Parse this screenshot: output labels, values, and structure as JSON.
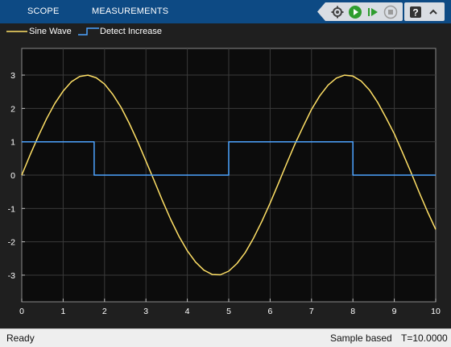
{
  "toolstrip": {
    "tabs": [
      "SCOPE",
      "MEASUREMENTS"
    ],
    "quick_access": [
      "settings-icon",
      "run-icon",
      "step-forward-icon",
      "stop-icon",
      "help-icon",
      "collapse-icon"
    ],
    "colors": {
      "bar": "#0d4a84",
      "run": "#2e9d2e",
      "stop": "#9a9a9a"
    }
  },
  "legend": {
    "items": [
      {
        "label": "Sine Wave",
        "color": "#ffe066"
      },
      {
        "label": "Detect Increase",
        "color": "#4da3ff"
      }
    ]
  },
  "chart_data": {
    "type": "line",
    "xlim": [
      0,
      10
    ],
    "ylim": [
      -3.8,
      3.8
    ],
    "xticks": [
      0,
      1,
      2,
      3,
      4,
      5,
      6,
      7,
      8,
      9,
      10
    ],
    "yticks": [
      -3,
      -2,
      -1,
      0,
      1,
      2,
      3
    ],
    "grid": true,
    "legend_placement": "top-left",
    "series": [
      {
        "name": "Sine Wave",
        "color": "#ffe066",
        "step": false,
        "x": [
          0,
          0.2,
          0.4,
          0.6,
          0.8,
          1.0,
          1.2,
          1.4,
          1.6,
          1.8,
          2.0,
          2.2,
          2.4,
          2.6,
          2.8,
          3.0,
          3.2,
          3.4,
          3.6,
          3.8,
          4.0,
          4.2,
          4.4,
          4.6,
          4.8,
          5.0,
          5.2,
          5.4,
          5.6,
          5.8,
          6.0,
          6.2,
          6.4,
          6.6,
          6.8,
          7.0,
          7.2,
          7.4,
          7.6,
          7.8,
          8.0,
          8.2,
          8.4,
          8.6,
          8.8,
          9.0,
          9.2,
          9.4,
          9.6,
          9.8,
          10.0
        ],
        "values": [
          0,
          0.6,
          1.17,
          1.69,
          2.15,
          2.52,
          2.8,
          2.96,
          3.0,
          2.92,
          2.73,
          2.42,
          2.03,
          1.55,
          1.01,
          0.42,
          -0.17,
          -0.77,
          -1.33,
          -1.84,
          -2.27,
          -2.61,
          -2.85,
          -2.98,
          -2.99,
          -2.88,
          -2.65,
          -2.32,
          -1.89,
          -1.39,
          -0.84,
          -0.25,
          0.35,
          0.93,
          1.46,
          1.97,
          2.38,
          2.7,
          2.91,
          3.0,
          2.97,
          2.82,
          2.55,
          2.18,
          1.72,
          1.24,
          0.67,
          0.09,
          -0.51,
          -1.09,
          -1.63
        ]
      },
      {
        "name": "Detect Increase",
        "color": "#4da3ff",
        "step": true,
        "x": [
          0,
          1.75,
          1.75,
          5.0,
          5.0,
          8.0,
          8.0,
          10.0
        ],
        "values": [
          1,
          1,
          0,
          0,
          1,
          1,
          0,
          0
        ]
      }
    ]
  },
  "status": {
    "left": "Ready",
    "mode": "Sample based",
    "time": "T=10.0000"
  }
}
